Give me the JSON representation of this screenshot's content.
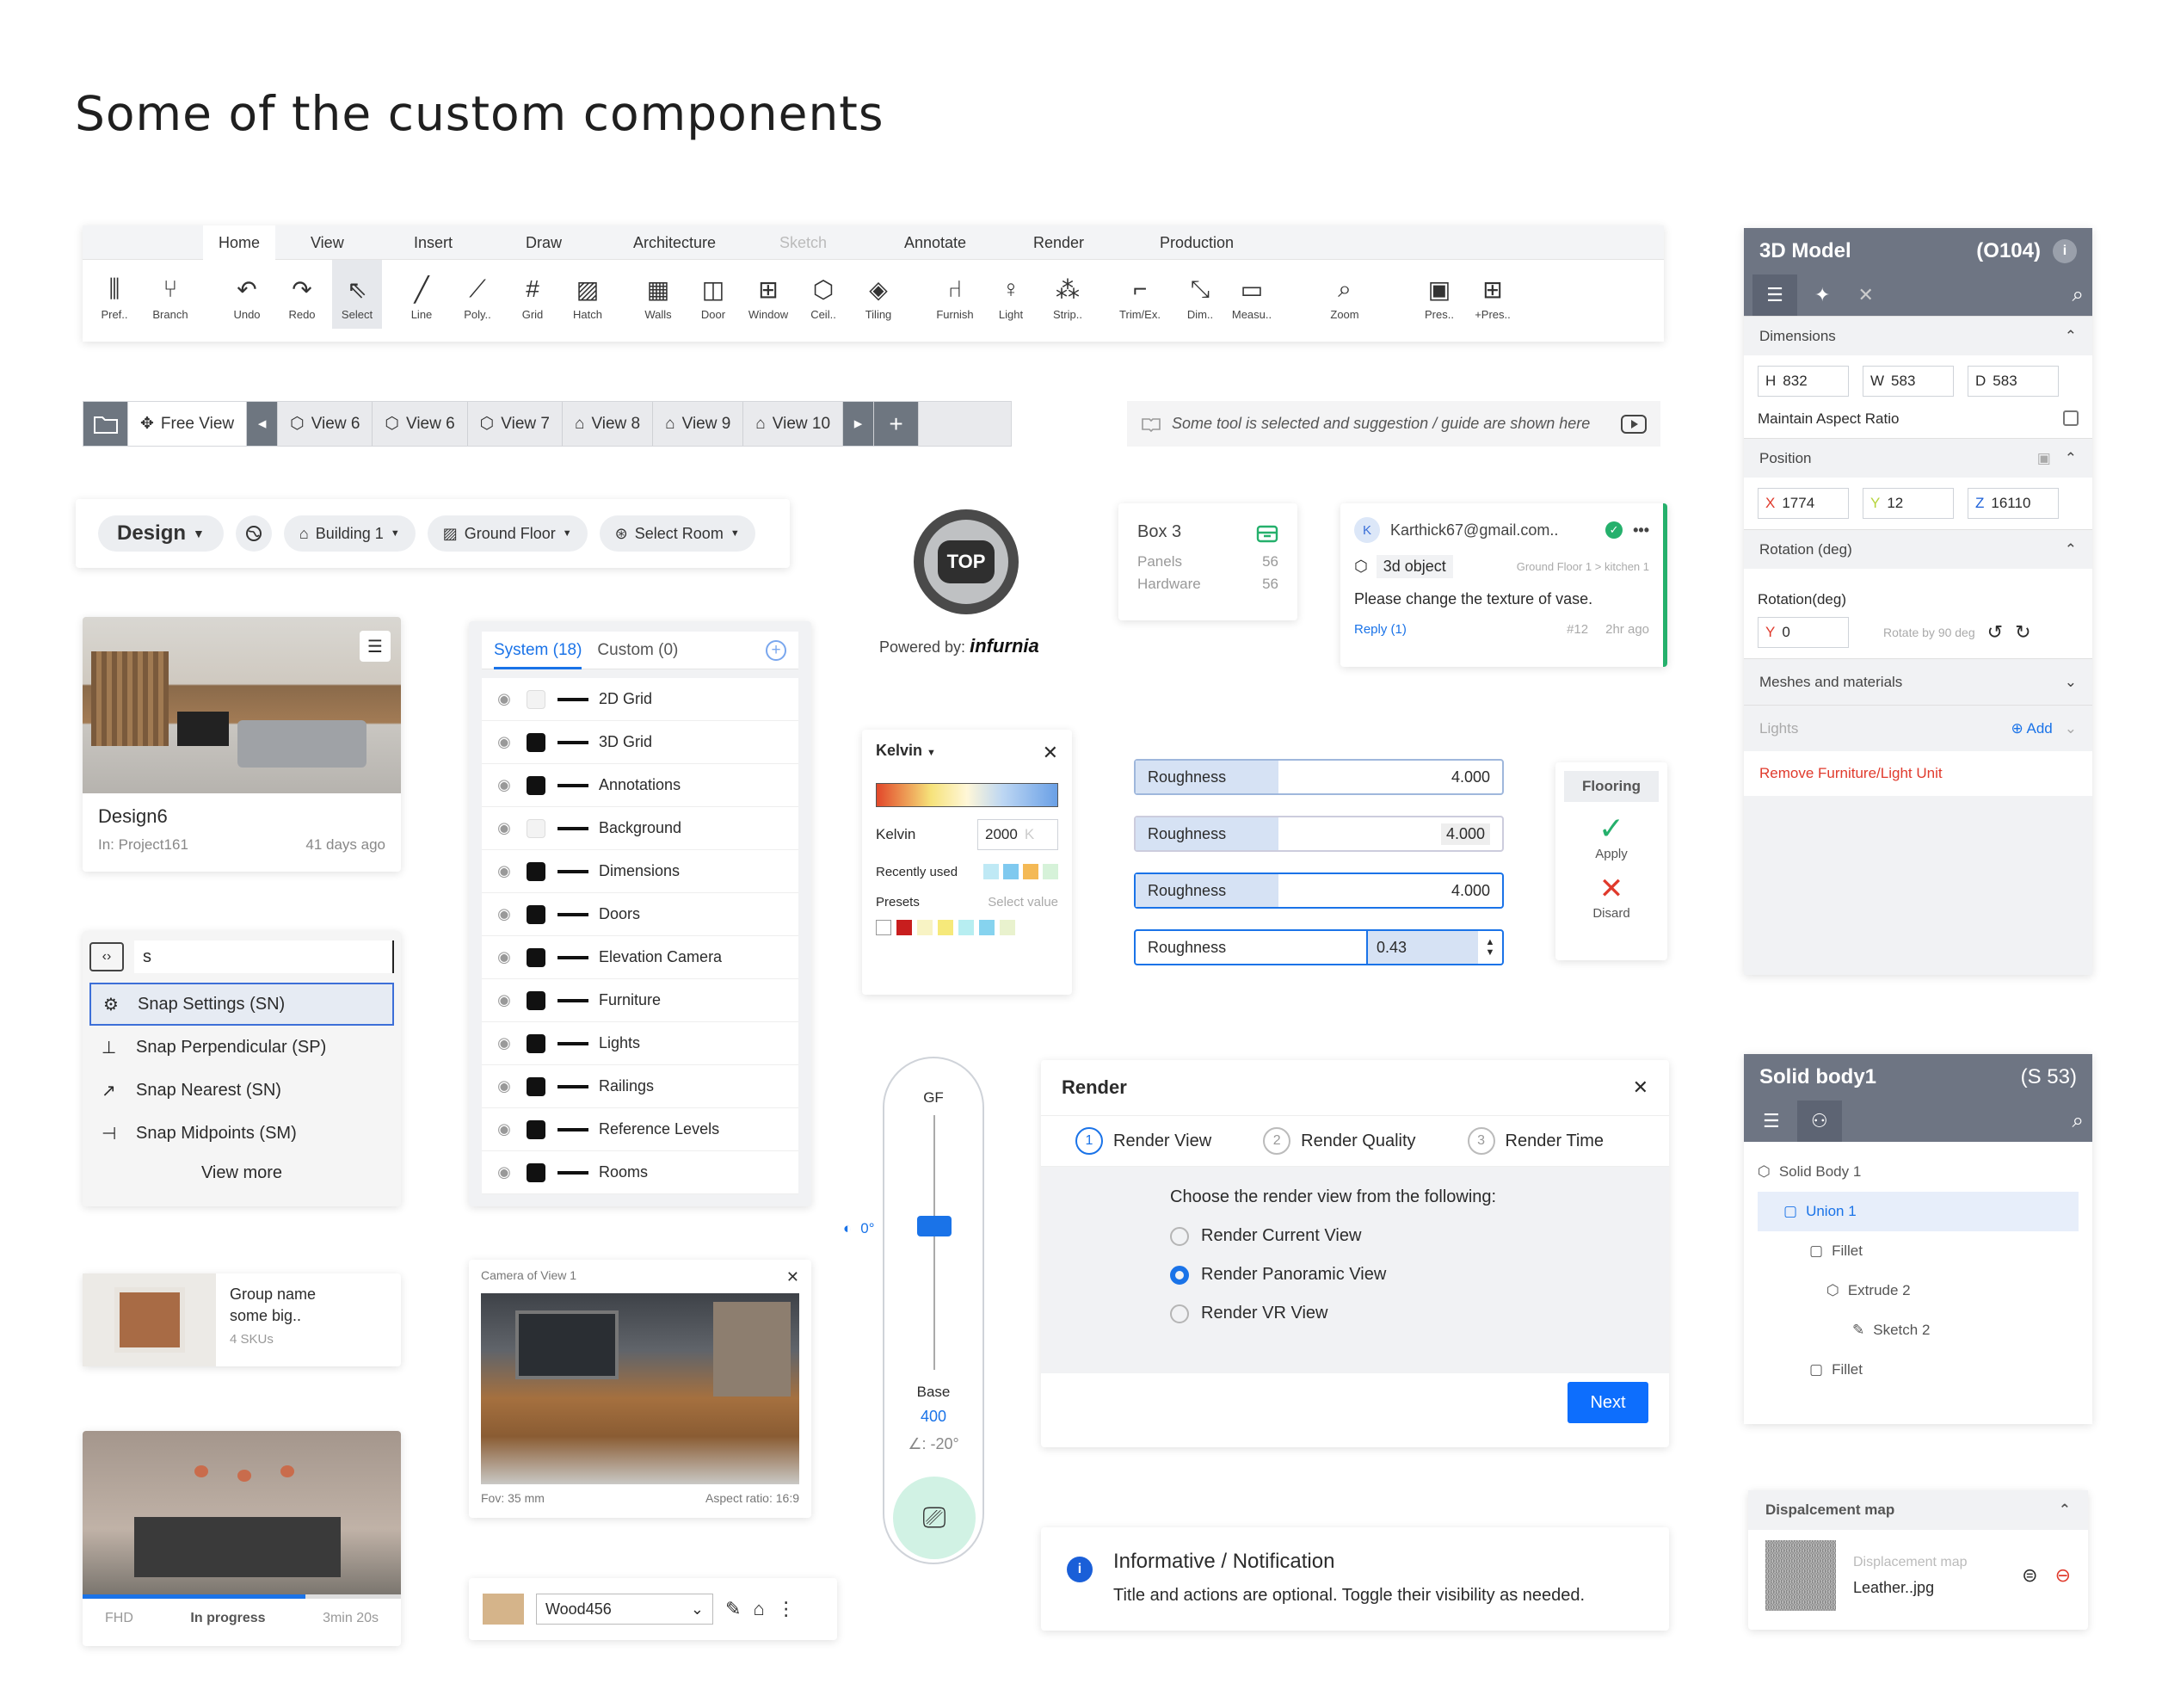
{
  "page_title": "Some of the custom components",
  "ribbon": {
    "tabs": [
      "Home",
      "View",
      "Insert",
      "Draw",
      "Architecture",
      "Sketch",
      "Annotate",
      "Render",
      "Production"
    ],
    "tools": [
      {
        "label": "Pref..",
        "icon": "sliders-icon"
      },
      {
        "label": "Branch",
        "icon": "branch-icon"
      },
      {
        "label": "Undo",
        "icon": "undo-icon"
      },
      {
        "label": "Redo",
        "icon": "redo-icon"
      },
      {
        "label": "Select",
        "icon": "select-cursor-icon"
      },
      {
        "label": "Line",
        "icon": "line-icon"
      },
      {
        "label": "Poly..",
        "icon": "polyline-icon"
      },
      {
        "label": "Grid",
        "icon": "grid-icon"
      },
      {
        "label": "Hatch",
        "icon": "hatch-icon"
      },
      {
        "label": "Walls",
        "icon": "walls-icon"
      },
      {
        "label": "Door",
        "icon": "door-icon"
      },
      {
        "label": "Window",
        "icon": "window-icon"
      },
      {
        "label": "Ceil..",
        "icon": "ceiling-icon"
      },
      {
        "label": "Tiling",
        "icon": "tiling-icon"
      },
      {
        "label": "Furnish",
        "icon": "furnish-icon"
      },
      {
        "label": "Light",
        "icon": "light-bulb-icon"
      },
      {
        "label": "Strip..",
        "icon": "strip-icon"
      },
      {
        "label": "Trim/Ex.",
        "icon": "trim-icon"
      },
      {
        "label": "Dim..",
        "icon": "dimension-icon"
      },
      {
        "label": "Measu..",
        "icon": "ruler-icon"
      },
      {
        "label": "Zoom",
        "icon": "zoom-icon"
      },
      {
        "label": "Pres..",
        "icon": "present-icon"
      },
      {
        "label": "+Pres..",
        "icon": "add-present-icon"
      }
    ]
  },
  "view_tabs": {
    "free_view": "Free View",
    "views": [
      "View 6",
      "View 6",
      "View 7",
      "View 8",
      "View 9",
      "View 10"
    ]
  },
  "tip": "Some tool is selected and suggestion / guide are shown here",
  "design_bar": {
    "design": "Design",
    "building": "Building 1",
    "floor": "Ground Floor",
    "room": "Select Room"
  },
  "compass": {
    "label": "TOP",
    "powered": "Powered by:",
    "brand": "infurnia"
  },
  "box_card": {
    "title": "Box 3",
    "rows": [
      {
        "k": "Panels",
        "v": "56"
      },
      {
        "k": "Hardware",
        "v": "56"
      }
    ]
  },
  "comment": {
    "avatar": "K",
    "email": "Karthick67@gmail.com..",
    "object": "3d object",
    "path": "Ground Floor 1 > kitchen 1",
    "text": "Please change the texture of vase.",
    "reply": "Reply (1)",
    "num": "#12",
    "time": "2hr ago"
  },
  "design_card": {
    "name": "Design6",
    "project": "In: Project161",
    "age": "41 days ago"
  },
  "layers": {
    "system": "System (18)",
    "custom": "Custom (0)",
    "items": [
      "2D Grid",
      "3D Grid",
      "Annotations",
      "Background",
      "Dimensions",
      "Doors",
      "Elevation Camera",
      "Furniture",
      "Lights",
      "Railings",
      "Reference Levels",
      "Rooms"
    ]
  },
  "snap": {
    "query": "s",
    "items": [
      "Snap Settings (SN)",
      "Snap Perpendicular (SP)",
      "Snap Nearest (SN)",
      "Snap Midpoints (SM)"
    ],
    "more": "View more"
  },
  "kelvin": {
    "title": "Kelvin",
    "label": "Kelvin",
    "value": "2000",
    "unit": "K",
    "recent": "Recently used",
    "presets": "Presets",
    "select": "Select value"
  },
  "rough": {
    "label": "Roughness",
    "v1": "4.000",
    "v2": "4.000",
    "v3": "4.000",
    "v4": "0.43"
  },
  "flooring": {
    "title": "Flooring",
    "apply": "Apply",
    "discard": "Disard"
  },
  "elev": {
    "top": "GF",
    "angle": "0°",
    "bottom": "Base",
    "value": "400",
    "tilt": "∠: -20°"
  },
  "render": {
    "title": "Render",
    "steps": [
      {
        "n": "1",
        "t": "Render View"
      },
      {
        "n": "2",
        "t": "Render Quality"
      },
      {
        "n": "3",
        "t": "Render Time"
      }
    ],
    "prompt": "Choose the render view from the following:",
    "options": [
      "Render Current View",
      "Render Panoramic View",
      "Render VR View"
    ],
    "next": "Next"
  },
  "notif": {
    "title": "Informative / Notification",
    "text": "Title and actions are optional. Toggle their visibility as needed."
  },
  "group": {
    "name": "Group name",
    "sub": "some big..",
    "skus": "4 SKUs"
  },
  "camera": {
    "title": "Camera of View 1",
    "fov": "Fov: 35 mm",
    "aspect": "Aspect ratio: 16:9"
  },
  "wood": {
    "value": "Wood456"
  },
  "render_card": {
    "res": "FHD",
    "status": "In progress",
    "time": "3min 20s"
  },
  "model": {
    "title": "3D Model",
    "code": "(O104)",
    "dims": "Dimensions",
    "h": "H",
    "hv": "832",
    "w": "W",
    "wv": "583",
    "d": "D",
    "dv": "583",
    "aspect": "Maintain Aspect Ratio",
    "position": "Position",
    "x": "X",
    "xv": "1774",
    "y": "Y",
    "yv": "12",
    "z": "Z",
    "zv": "16110",
    "rotation": "Rotation (deg)",
    "rot_label": "Rotation(deg)",
    "ry": "Y",
    "ryv": "0",
    "rot90": "Rotate by 90 deg",
    "meshes": "Meshes and materials",
    "lights": "Lights",
    "add": "Add",
    "remove": "Remove Furniture/Light Unit"
  },
  "solid": {
    "title": "Solid body1",
    "code": "(S 53)",
    "tree": [
      "Solid Body 1",
      "Union 1",
      "Fillet",
      "Extrude 2",
      "Sketch 2",
      "Fillet"
    ]
  },
  "disp": {
    "title": "Dispalcement map",
    "label": "Displacement map",
    "file": "Leather..jpg"
  }
}
